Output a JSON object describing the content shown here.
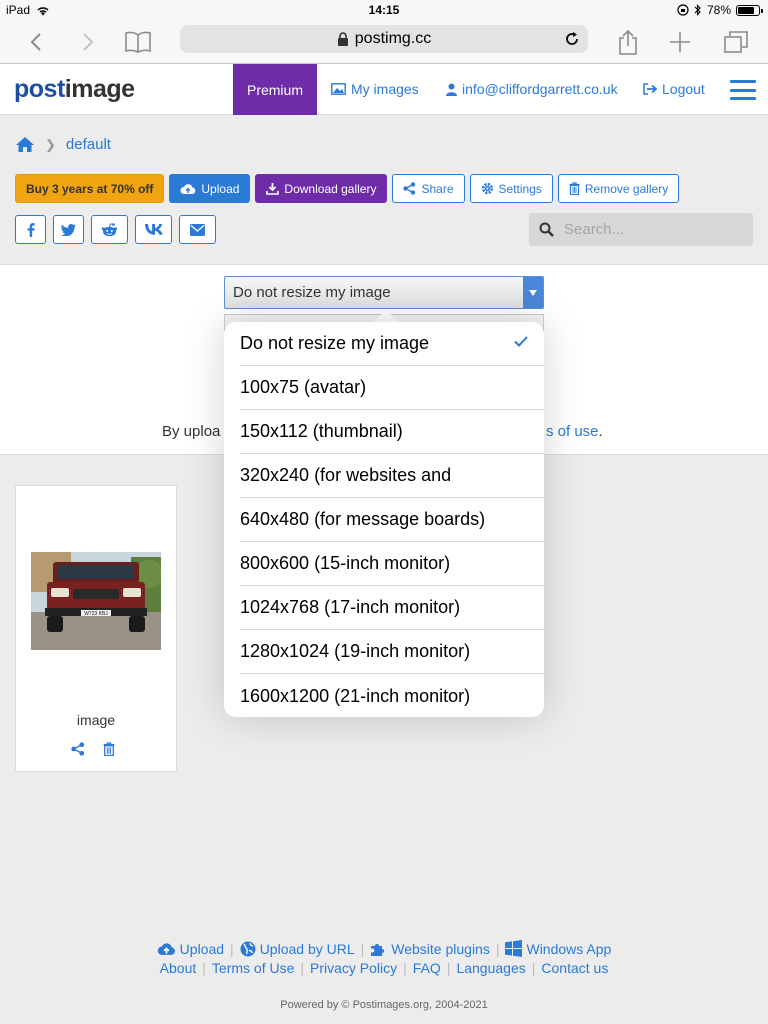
{
  "status_bar": {
    "device": "iPad",
    "time": "14:15",
    "battery": "78%",
    "battery_level": 0.78
  },
  "browser": {
    "url": "postimg.cc"
  },
  "header": {
    "logo_post": "post",
    "logo_image": "image",
    "premium": "Premium",
    "my_images": "My images",
    "email": "info@cliffordgarrett.co.uk",
    "logout": "Logout"
  },
  "breadcrumb": {
    "current": "default"
  },
  "actions": {
    "buy": "Buy 3 years at 70% off",
    "upload": "Upload",
    "download_gallery": "Download gallery",
    "share": "Share",
    "settings": "Settings",
    "remove_gallery": "Remove gallery"
  },
  "search": {
    "placeholder": "Search..."
  },
  "upload_panel": {
    "resize_selected": "Do not resize my image",
    "terms_prefix": "By uploa",
    "terms_link": "s of use",
    "terms_suffix": "."
  },
  "resize_options": [
    {
      "label": "Do not resize my image",
      "selected": true
    },
    {
      "label": "100x75 (avatar)"
    },
    {
      "label": "150x112 (thumbnail)"
    },
    {
      "label": "320x240 (for websites and"
    },
    {
      "label": "640x480 (for message boards)"
    },
    {
      "label": "800x600 (15-inch monitor)"
    },
    {
      "label": "1024x768 (17-inch monitor)"
    },
    {
      "label": "1280x1024 (19-inch monitor)"
    },
    {
      "label": "1600x1200 (21-inch monitor)"
    }
  ],
  "gallery": {
    "items": [
      {
        "label": "image",
        "plate": "W723 KBJ"
      }
    ]
  },
  "footer": {
    "upload": "Upload",
    "upload_url": "Upload by URL",
    "plugins": "Website plugins",
    "windows_app": "Windows App",
    "about": "About",
    "terms": "Terms of Use",
    "privacy": "Privacy Policy",
    "faq": "FAQ",
    "languages": "Languages",
    "contact": "Contact us",
    "powered": "Powered by © Postimages.org, 2004-2021"
  },
  "colors": {
    "accent": "#2a7ad6",
    "premium": "#6f2ca8",
    "warning": "#f0a40f"
  }
}
